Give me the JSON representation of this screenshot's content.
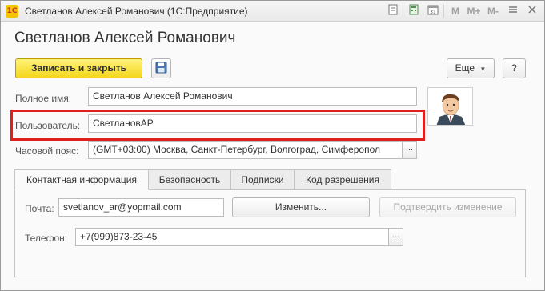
{
  "window": {
    "title": "Светланов Алексей Романович  (1С:Предприятие)",
    "logo_text": "1С",
    "toolbar_icons": [
      "document-icon",
      "calculator-icon",
      "calendar-icon",
      "m-icon",
      "m-plus-icon",
      "m-minus-icon",
      "menu-icon",
      "close-icon"
    ],
    "m_label": "M",
    "m_plus_label": "M+",
    "m_minus_label": "M-"
  },
  "page": {
    "title": "Светланов Алексей Романович"
  },
  "toolbar": {
    "save_close_label": "Записать и закрыть",
    "more_label": "Еще",
    "help_label": "?"
  },
  "form": {
    "full_name_label": "Полное имя:",
    "full_name_value": "Светланов Алексей Романович",
    "user_label": "Пользователь:",
    "user_value": "СветлановАР",
    "timezone_label": "Часовой пояс:",
    "timezone_value": "(GMT+03:00) Москва, Санкт-Петербург, Волгоград, Симферопол",
    "pick_label": "..."
  },
  "tabs": [
    {
      "label": "Контактная информация",
      "active": true
    },
    {
      "label": "Безопасность",
      "active": false
    },
    {
      "label": "Подписки",
      "active": false
    },
    {
      "label": "Код разрешения",
      "active": false
    }
  ],
  "contacts": {
    "email_label": "Почта:",
    "email_value": "svetlanov_ar@yopmail.com",
    "change_label": "Изменить...",
    "confirm_label": "Подтвердить изменение",
    "phone_label": "Телефон:",
    "phone_value": "+7(999)873-23-45"
  },
  "colors": {
    "primary_button": "#f3d61b",
    "highlight": "#e01f1f"
  }
}
